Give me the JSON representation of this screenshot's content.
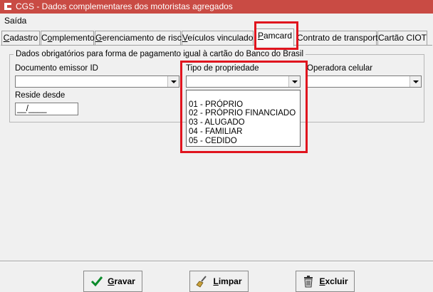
{
  "window": {
    "title": "CGS - Dados complementares dos motoristas agregados"
  },
  "menu": {
    "items": [
      "Saída"
    ]
  },
  "tabs": [
    {
      "label": "Cadastro",
      "u": "C",
      "rest": "adastro"
    },
    {
      "label": "Complemento",
      "u": "o",
      "pre": "C",
      "rest": "mplemento"
    },
    {
      "label": "Gerenciamento de risco",
      "u": "G",
      "rest": "erenciamento de risco"
    },
    {
      "label": "Veículos vinculado",
      "u": "V",
      "rest": "eículos vinculado"
    },
    {
      "label": "Pamcard",
      "u": "P",
      "rest": "amcard"
    },
    {
      "label": "Contrato de transporte",
      "u": "",
      "rest": "Contrato de transporte"
    },
    {
      "label": "Cartão CIOT",
      "u": "",
      "rest": "Cartão CIOT"
    }
  ],
  "form": {
    "group_title": "Dados obrigatórios para forma de pagamento igual à cartão do Banco do Brasil",
    "doc_emissor_label": "Documento emissor ID",
    "tipo_propriedade_label": "Tipo de propriedade",
    "operadora_label": "Operadora celular",
    "reside_desde_label": "Reside desde",
    "reside_desde_value": "__/____"
  },
  "dropdown_options": [
    "01 - PRÓPRIO",
    "02 - PRÓPRIO FINANCIADO",
    "03 - ALUGADO",
    "04 - FAMILIAR",
    "05 - CEDIDO"
  ],
  "buttons": {
    "gravar": {
      "u": "G",
      "rest": "ravar"
    },
    "limpar": {
      "u": "L",
      "rest": "impar"
    },
    "excluir": {
      "u": "E",
      "rest": "xcluir"
    }
  },
  "colors": {
    "titlebar": "#c94b44",
    "highlight": "#e0141e"
  }
}
